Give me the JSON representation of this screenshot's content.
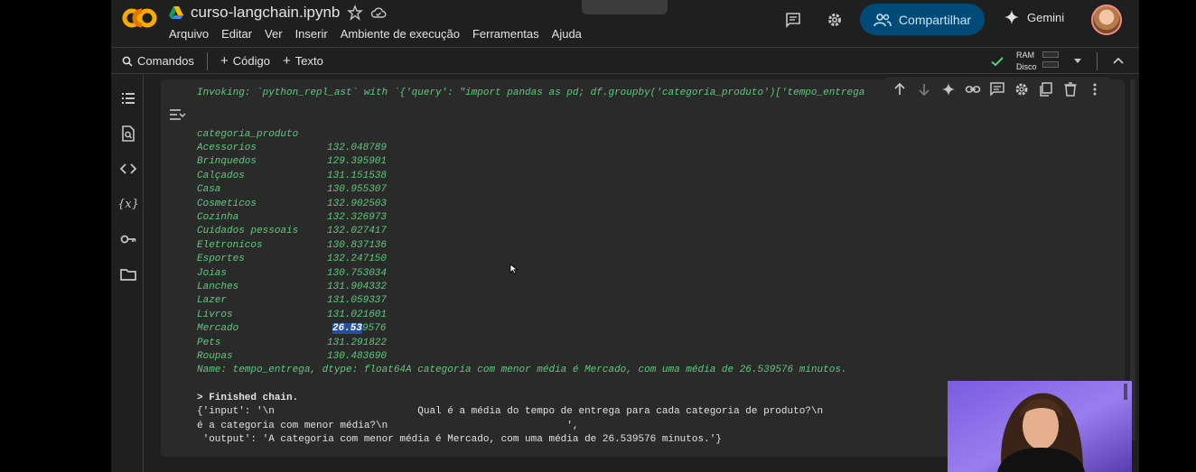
{
  "header": {
    "filename": "curso-langchain.ipynb",
    "menu": [
      "Arquivo",
      "Editar",
      "Ver",
      "Inserir",
      "Ambiente de execução",
      "Ferramentas",
      "Ajuda"
    ],
    "share_label": "Compartilhar",
    "gemini_label": "Gemini"
  },
  "toolbar": {
    "commands_label": "Comandos",
    "code_label": "Código",
    "text_label": "Texto",
    "ram_label": "RAM",
    "disk_label": "Disco"
  },
  "output": {
    "invoking_line": "Invoking: `python_repl_ast` with `{'query': \"import pandas as pd; df.groupby('categoria_produto')['tempo_entrega",
    "index_header": "categoria_produto",
    "rows": [
      {
        "category": "Acessorios",
        "value": "132.048789"
      },
      {
        "category": "Brinquedos",
        "value": "129.395901"
      },
      {
        "category": "Calçados",
        "value": "131.151538"
      },
      {
        "category": "Casa",
        "value": "130.955307"
      },
      {
        "category": "Cosmeticos",
        "value": "132.902503"
      },
      {
        "category": "Cozinha",
        "value": "132.326973"
      },
      {
        "category": "Cuidados pessoais",
        "value": "132.027417"
      },
      {
        "category": "Eletronicos",
        "value": "130.837136"
      },
      {
        "category": "Esportes",
        "value": "132.247150"
      },
      {
        "category": "Joias",
        "value": "130.753034"
      },
      {
        "category": "Lanches",
        "value": "131.904332"
      },
      {
        "category": "Lazer",
        "value": "131.059337"
      },
      {
        "category": "Livros",
        "value": "131.021601"
      },
      {
        "category": "Mercado",
        "value": "9576",
        "value_highlight": "26.53"
      },
      {
        "category": "Pets",
        "value": "131.291822"
      },
      {
        "category": "Roupas",
        "value": "130.483690"
      }
    ],
    "name_line": "Name: tempo_entrega, dtype: float64",
    "answer_line": "A categoria com menor média é Mercado, com uma média de 26.539576 minutos.",
    "finished": "> Finished chain.",
    "result_line1": "{'input': '\\n                        Qual é a média do tempo de entrega para cada categoria de produto?\\n",
    "result_line2": "é a categoria com menor média?\\n                              ',",
    "result_line3": " 'output': 'A categoria com menor média é Mercado, com uma média de 26.539576 minutos.'}"
  }
}
